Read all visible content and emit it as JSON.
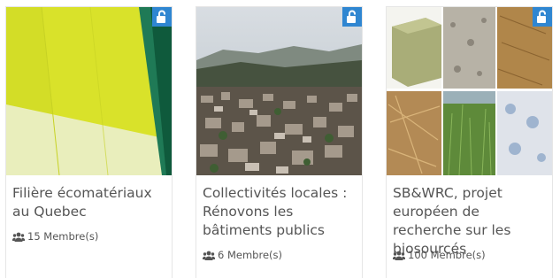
{
  "accent_color": "#2f86d1",
  "text_color": "#555555",
  "cards": [
    {
      "title": "Filière écomatériaux au Quebec",
      "members": "15 Membre(s)",
      "lock_icon": "unlock-icon",
      "members_icon": "users-icon"
    },
    {
      "title": "Collectivités locales : Rénovons les bâtiments publics",
      "members": "6 Membre(s)",
      "lock_icon": "unlock-icon",
      "members_icon": "users-icon"
    },
    {
      "title": "SB&WRC, projet européen de recherche sur les biosourcés",
      "members": "100 Membre(s)",
      "lock_icon": "unlock-icon",
      "members_icon": "users-icon"
    }
  ]
}
